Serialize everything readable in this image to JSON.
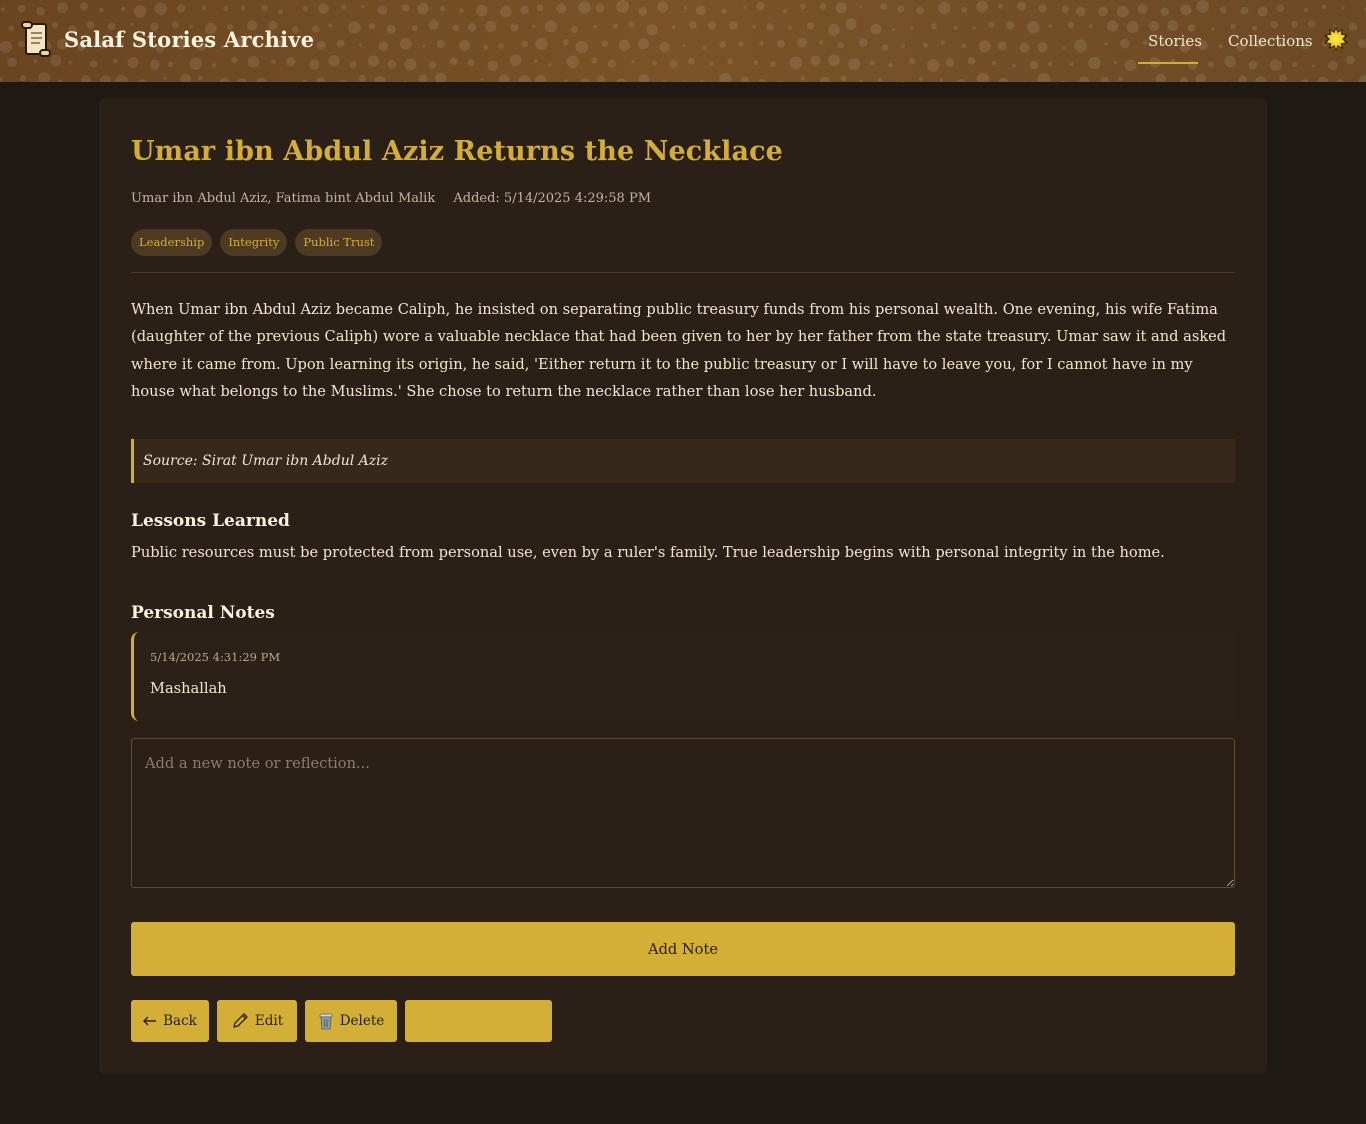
{
  "app": {
    "title": "Salaf Stories Archive",
    "logo_icon": "scroll-icon"
  },
  "nav": {
    "items": [
      {
        "label": "Stories",
        "active": true
      },
      {
        "label": "Collections",
        "active": false
      }
    ],
    "theme_toggle_icon": "sun-icon"
  },
  "story": {
    "title": "Umar ibn Abdul Aziz Returns the Necklace",
    "people": "Umar ibn Abdul Aziz, Fatima bint Abdul Malik",
    "added": "Added: 5/14/2025 4:29:58 PM",
    "tags": [
      "Leadership",
      "Integrity",
      "Public Trust"
    ],
    "body": "When Umar ibn Abdul Aziz became Caliph, he insisted on separating public treasury funds from his personal wealth. One evening, his wife Fatima (daughter of the previous Caliph) wore a valuable necklace that had been given to her by her father from the state treasury. Umar saw it and asked where it came from. Upon learning its origin, he said, 'Either return it to the public treasury or I will have to leave you, for I cannot have in my house what belongs to the Muslims.' She chose to return the necklace rather than lose her husband.",
    "source": "Source: Sirat Umar ibn Abdul Aziz"
  },
  "lessons": {
    "heading": "Lessons Learned",
    "text": "Public resources must be protected from personal use, even by a ruler's family. True leadership begins with personal integrity in the home."
  },
  "notes": {
    "heading": "Personal Notes",
    "items": [
      {
        "date": "5/14/2025 4:31:29 PM",
        "text": "Mashallah"
      }
    ],
    "input_placeholder": "Add a new note or reflection...",
    "add_label": "Add Note"
  },
  "actions": {
    "back_label": "Back",
    "back_icon": "arrow-left-icon",
    "edit_label": "Edit",
    "edit_icon": "pencil-icon",
    "delete_label": "Delete",
    "delete_icon": "trash-icon"
  },
  "colors": {
    "accent": "#d4af37",
    "background": "#1f1913",
    "card": "#2a2018",
    "header": "#7a5326"
  }
}
